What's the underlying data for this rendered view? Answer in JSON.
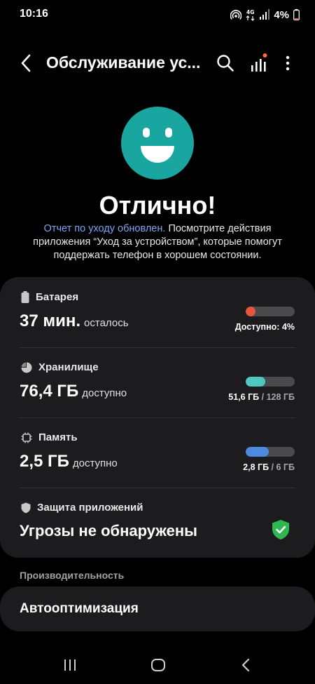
{
  "status_bar": {
    "time": "10:16",
    "battery_percent": "4%",
    "icons": [
      "hotspot-icon",
      "4g-data-icon",
      "signal-icon",
      "battery-icon"
    ]
  },
  "app_bar": {
    "title": "Обслуживание ус...",
    "icons": [
      "back-icon",
      "search-icon",
      "stats-icon",
      "more-icon"
    ]
  },
  "hero": {
    "heading": "Отлично!",
    "link_text": "Отчет по уходу обновлен.",
    "description": " Посмотрите действия приложения “Уход за устройством”, которые помогут поддержать телефон в хорошем состоянии.",
    "face_color": "#19a6a0"
  },
  "battery": {
    "label": "Батарея",
    "value": "37 мин.",
    "suffix": "осталось",
    "detail": "Доступно: 4%",
    "level": 0.04,
    "color": "#e8553d"
  },
  "storage": {
    "label": "Хранилище",
    "value": "76,4 ГБ",
    "suffix": "доступно",
    "used": "51,6 ГБ",
    "total": "/ 128 ГБ",
    "level": 0.403,
    "color": "#4fc8c2"
  },
  "memory": {
    "label": "Память",
    "value": "2,5 ГБ",
    "suffix": "доступно",
    "used": "2,8 ГБ",
    "total": "/ 6 ГБ",
    "level": 0.467,
    "color": "#4d89e0"
  },
  "protection": {
    "label": "Защита приложений",
    "value": "Угрозы не обнаружены",
    "status_color": "#2fb84f"
  },
  "performance": {
    "section_title": "Производительность",
    "auto_opt_label": "Автооптимизация"
  }
}
